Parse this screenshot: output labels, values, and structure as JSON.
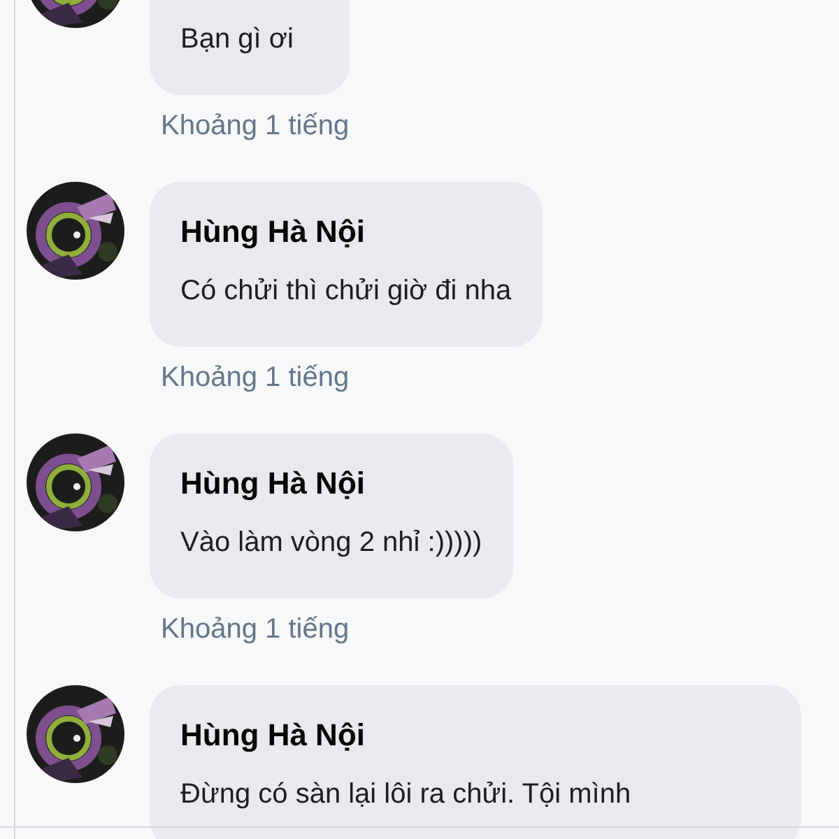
{
  "comments": [
    {
      "message": "Bạn gì ơi",
      "time": "Khoảng 1 tiếng"
    },
    {
      "author": "Hùng Hà Nội",
      "message": "Có chửi thì chửi giờ đi nha",
      "time": "Khoảng 1 tiếng"
    },
    {
      "author": "Hùng Hà Nội",
      "message": "Vào làm vòng 2 nhỉ :)))))",
      "time": "Khoảng 1 tiếng"
    },
    {
      "author": "Hùng Hà Nội",
      "message": "Đừng có sàn lại lôi ra chửi. Tội mình"
    }
  ]
}
